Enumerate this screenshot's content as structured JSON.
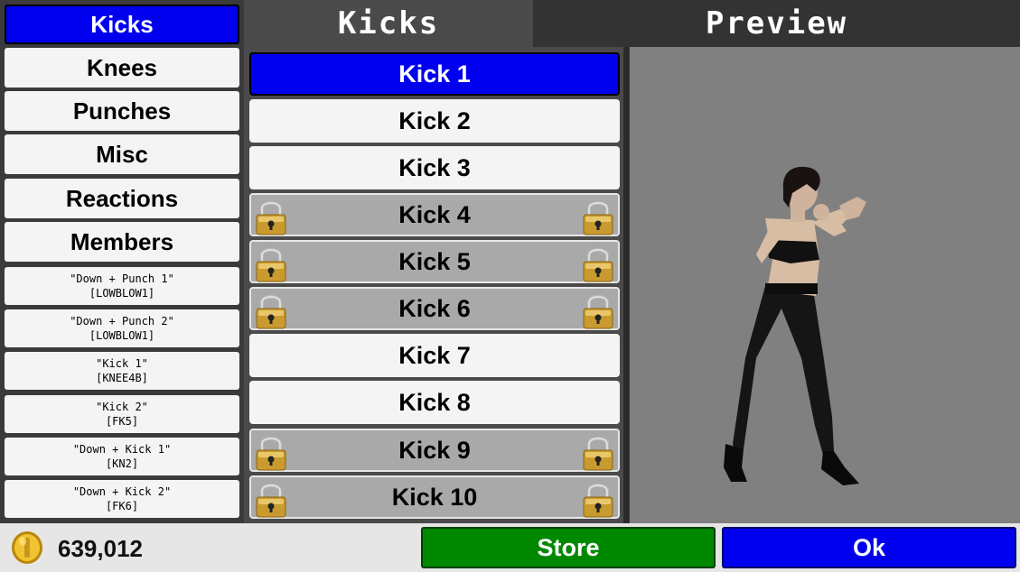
{
  "header": {
    "list_title": "Kicks",
    "preview_title": "Preview"
  },
  "categories": [
    {
      "label": "Kicks",
      "selected": true
    },
    {
      "label": "Knees"
    },
    {
      "label": "Punches"
    },
    {
      "label": "Misc"
    },
    {
      "label": "Reactions"
    },
    {
      "label": "Members"
    }
  ],
  "moves": [
    {
      "name": "\"Down + Punch 1\"",
      "code": "[LOWBLOW1]"
    },
    {
      "name": "\"Down + Punch 2\"",
      "code": "[LOWBLOW1]"
    },
    {
      "name": "\"Kick 1\"",
      "code": "[KNEE4B]"
    },
    {
      "name": "\"Kick 2\"",
      "code": "[FK5]"
    },
    {
      "name": "\"Down + Kick 1\"",
      "code": "[KN2]"
    },
    {
      "name": "\"Down + Kick 2\"",
      "code": "[FK6]"
    }
  ],
  "kicks": [
    {
      "label": "Kick 1",
      "selected": true,
      "locked": false
    },
    {
      "label": "Kick 2",
      "locked": false
    },
    {
      "label": "Kick 3",
      "locked": false
    },
    {
      "label": "Kick 4",
      "locked": true
    },
    {
      "label": "Kick 5",
      "locked": true
    },
    {
      "label": "Kick 6",
      "locked": true
    },
    {
      "label": "Kick 7",
      "locked": false
    },
    {
      "label": "Kick 8",
      "locked": false
    },
    {
      "label": "Kick 9",
      "locked": true
    },
    {
      "label": "Kick 10",
      "locked": true
    }
  ],
  "footer": {
    "coins": "639,012",
    "store_label": "Store",
    "ok_label": "Ok"
  },
  "icons": {
    "coin": "gold-coin-icon",
    "lock": "padlock-icon"
  },
  "colors": {
    "selected": "#0000ee",
    "store": "#008800",
    "ok": "#0000ee",
    "locked_row": "#a9a9a9"
  }
}
